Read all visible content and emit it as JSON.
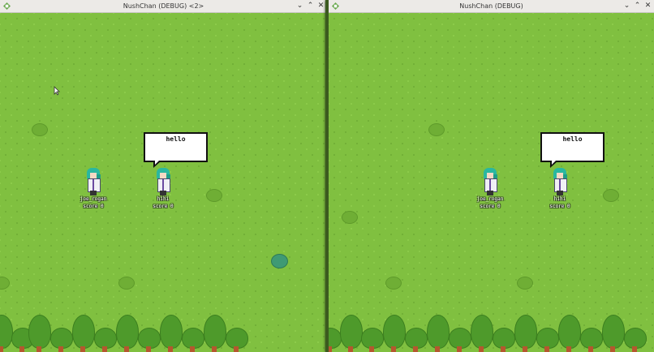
{
  "windows": [
    {
      "title": "NushChan (DEBUG) <2>",
      "characters": [
        {
          "name": "joe_rogan",
          "score": "score 0"
        },
        {
          "name": "hihi",
          "score": "score 0"
        }
      ],
      "bubble": "hello"
    },
    {
      "title": "NushChan (DEBUG)",
      "characters": [
        {
          "name": "joe_rogan",
          "score": "score 0"
        },
        {
          "name": "hihi",
          "score": "score 0"
        }
      ],
      "bubble": "hello"
    }
  ],
  "controls": {
    "minimize": "⌄",
    "maximize": "⌃",
    "close": "✕"
  },
  "colors": {
    "grass": "#80c040",
    "tree": "#4e9a2b",
    "teal_bush": "#3f9a74",
    "hair": "#2ab7a0"
  },
  "icons": [
    "app-icon",
    "minimize-icon",
    "maximize-icon",
    "close-icon",
    "mouse-cursor-icon"
  ]
}
